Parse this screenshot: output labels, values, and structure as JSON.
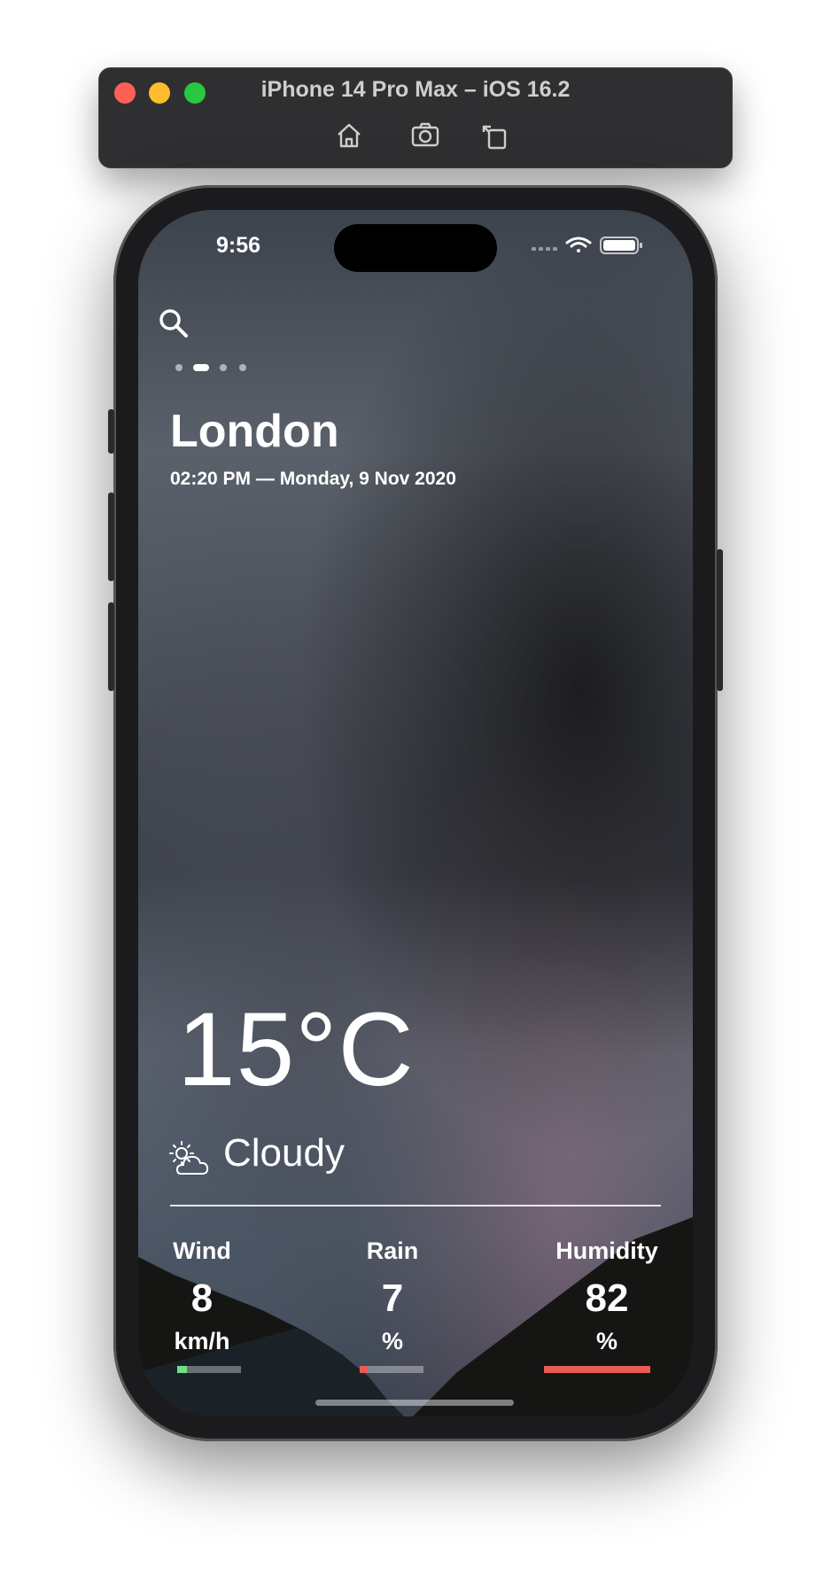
{
  "simulator": {
    "title": "iPhone 14 Pro Max – iOS 16.2",
    "tools": [
      "home-icon",
      "screenshot-icon",
      "rotate-icon"
    ]
  },
  "status_bar": {
    "time": "9:56",
    "icons": [
      "cellular-icon",
      "wifi-icon",
      "battery-icon"
    ]
  },
  "header": {
    "search_icon": "search-icon",
    "page_count": 4,
    "active_page_index": 1
  },
  "location": {
    "city": "London",
    "datetime": "02:20 PM — Monday, 9 Nov 2020"
  },
  "current": {
    "temperature": "15°C",
    "condition": "Cloudy",
    "condition_icon": "partly-cloudy-icon"
  },
  "stats": [
    {
      "label": "Wind",
      "value": "8",
      "unit": "km/h",
      "level": 0.15,
      "color": "#6fe08a"
    },
    {
      "label": "Rain",
      "value": "7",
      "unit": "%",
      "level": 0.12,
      "color": "#e85b56"
    },
    {
      "label": "Humidity",
      "value": "82",
      "unit": "%",
      "level": 1.0,
      "color": "#e85b56"
    }
  ],
  "colors": {
    "text": "#ffffff",
    "bar_track": "rgba(255,255,255,0.35)"
  }
}
